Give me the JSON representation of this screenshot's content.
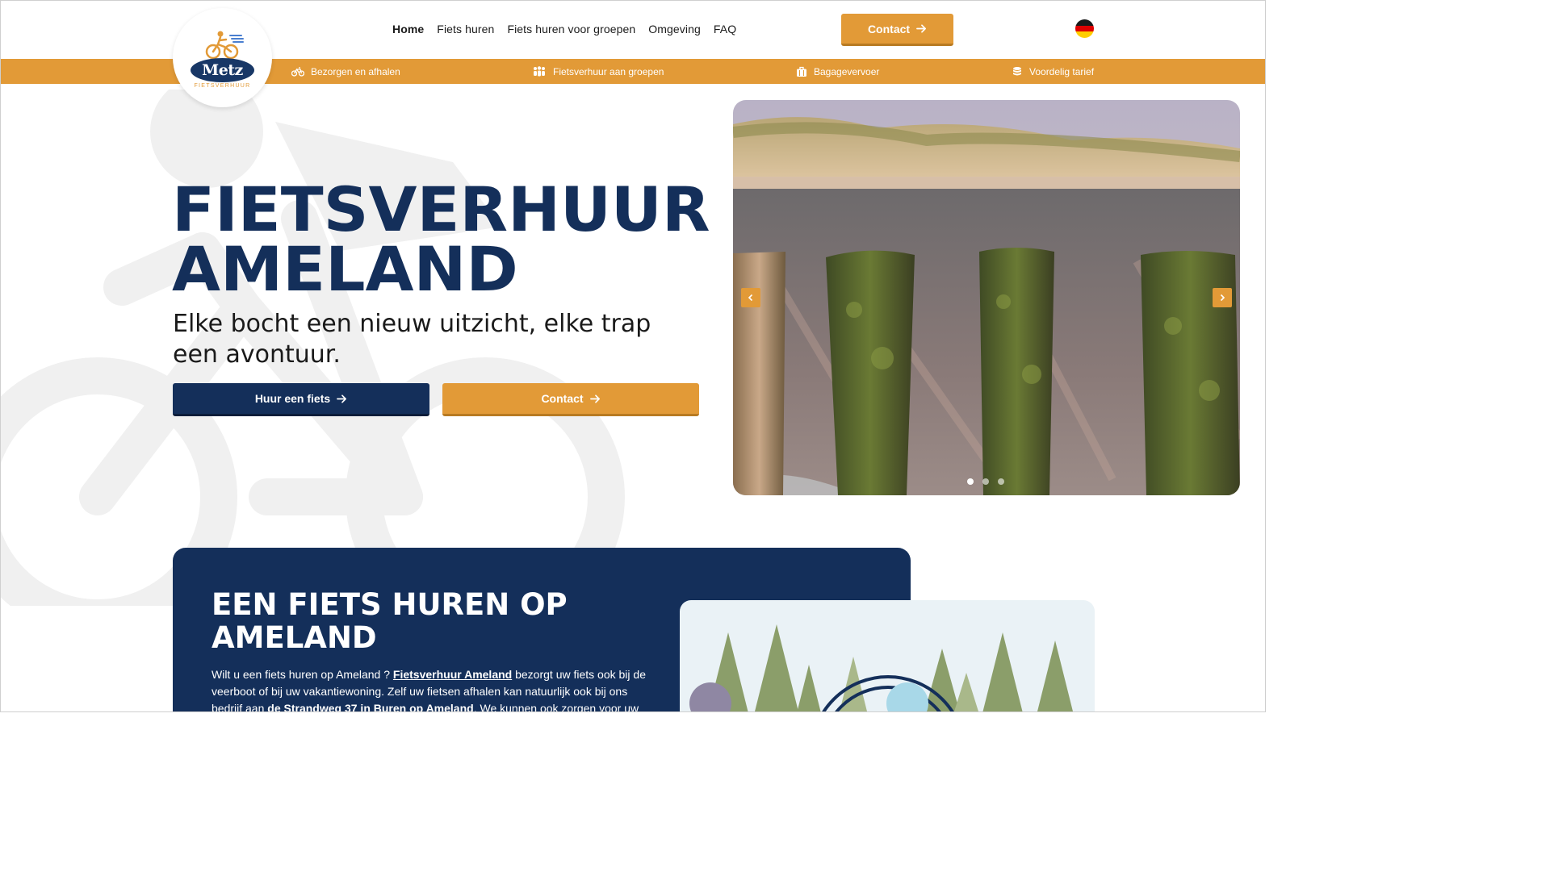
{
  "header": {
    "logo": {
      "brand": "Metz",
      "subtitle": "FIETSVERHUUR"
    },
    "nav": [
      {
        "label": "Home",
        "active": true
      },
      {
        "label": "Fiets huren",
        "active": false
      },
      {
        "label": "Fiets huren voor groepen",
        "active": false
      },
      {
        "label": "Omgeving",
        "active": false
      },
      {
        "label": "FAQ",
        "active": false
      }
    ],
    "contact_button": "Contact",
    "language_flag": "german-flag-icon"
  },
  "usp_bar": {
    "items": [
      {
        "label": "Bezorgen en afhalen",
        "icon": "bicycle-icon"
      },
      {
        "label": "Fietsverhuur aan groepen",
        "icon": "group-icon"
      },
      {
        "label": "Bagagevervoer",
        "icon": "luggage-icon"
      },
      {
        "label": "Voordelig tarief",
        "icon": "coins-icon"
      }
    ]
  },
  "hero": {
    "title_line1": "FIETSVERHUUR",
    "title_line2": "AMELAND",
    "subtitle": "Elke bocht een nieuw uitzicht, elke trap een avontuur.",
    "primary_button": "Huur een fiets",
    "secondary_button": "Contact"
  },
  "slider": {
    "prev_icon": "chevron-left-icon",
    "next_icon": "chevron-right-icon",
    "slide_count": 3,
    "active_slide": 1
  },
  "info": {
    "title_line1": "EEN FIETS HUREN OP",
    "title_line2": "AMELAND",
    "text_1": "Wilt u een fiets huren op Ameland ? ",
    "text_link": "Fietsverhuur Ameland",
    "text_2": " bezorgt uw fiets ook bij de veerboot of bij uw vakantiewoning. Zelf uw fietsen afhalen kan natuurlijk ook bij ons bedrijf aan ",
    "text_bold": "de Strandweg 37 in Buren op Ameland",
    "text_3": ". We kunnen ook zorgen voor uw"
  },
  "colors": {
    "navy": "#142f5a",
    "orange": "#e29a37",
    "white": "#ffffff"
  }
}
